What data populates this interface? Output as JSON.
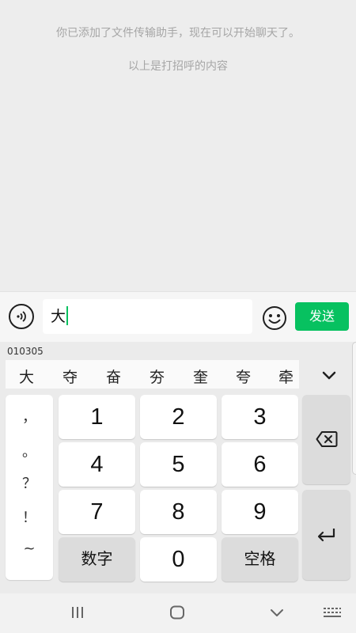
{
  "chat": {
    "system_messages": [
      "你已添加了文件传输助手，现在可以开始聊天了。",
      "以上是打招呼的内容"
    ]
  },
  "input_bar": {
    "voice_icon": "voice-icon",
    "text_value": "大",
    "emoji_icon": "emoji-icon",
    "send_label": "发送"
  },
  "keyboard": {
    "composition": "010305",
    "candidates": [
      "大",
      "夺",
      "奋",
      "夯",
      "奎",
      "夸",
      "牵"
    ],
    "collapse_icon": "chevron-down-icon",
    "punctuation": [
      "，",
      "。",
      "？",
      "！",
      "~"
    ],
    "digits": [
      "1",
      "2",
      "3",
      "4",
      "5",
      "6",
      "7",
      "8",
      "9",
      "0"
    ],
    "number_key_label": "数字",
    "space_key_label": "空格",
    "backspace_icon": "backspace-icon",
    "enter_icon": "enter-icon"
  },
  "nav_bar": {
    "recent_icon": "recent-apps-icon",
    "home_icon": "home-icon",
    "back_icon": "chevron-down-icon",
    "keyboard_icon": "keyboard-icon"
  },
  "colors": {
    "accent": "#07c160",
    "chat_background": "#ededed",
    "system_text": "#a6a6a6"
  }
}
